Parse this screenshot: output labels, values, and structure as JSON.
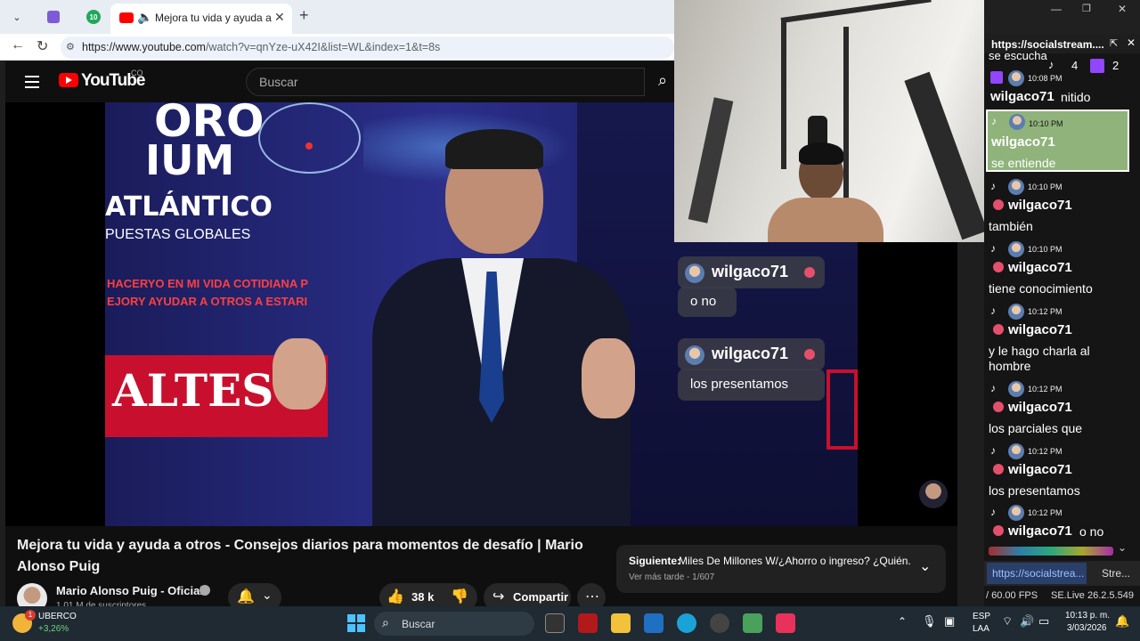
{
  "browser": {
    "tab_badge": "10",
    "active_tab_title": "Mejora tu vida y ayuda a otros - Consejos",
    "url_host": "https://www.youtube.com",
    "url_path": "/watch?v=qnYze-uX42I&list=WL&index=1&t=8s"
  },
  "youtube": {
    "logo_text": "YouTube",
    "country": "CO",
    "search_placeholder": "Buscar",
    "video_title": "Mejora tu vida y ayuda a otros - Consejos diarios para momentos de desafío | Mario Alonso Puig",
    "channel_name": "Mario Alonso Puig - Oficial",
    "subscribers": "1,01 M de suscriptores",
    "likes": "38 k",
    "share_label": "Compartir",
    "next_label": "Siguiente:",
    "next_title": "Miles De Millones W/¿Ahorro o ingreso? ¿Quién...",
    "next_sub": "Ver más tarde - 1/607"
  },
  "video_frame": {
    "line1": "ORO",
    "line2": "IUM",
    "line3": "ATLÁNTICO",
    "line4": "PUESTAS GLOBALES",
    "line5": "HACERYO EN MI VIDA COTIDIANA P",
    "line6": "EJORY AYUDAR A OTROS A ESTARI",
    "line7": "ALTES"
  },
  "overlay": {
    "bubbles": [
      {
        "user": "wilgaco71",
        "text": "o no"
      },
      {
        "user": "wilgaco71",
        "text": "los presentamos"
      }
    ]
  },
  "chat_panel": {
    "url": "https://socialstream....",
    "tiktok_count": "4",
    "twitch_count": "2",
    "top_partial": "se escucha",
    "messages": [
      {
        "time": "10:08 PM",
        "user": "wilgaco71",
        "text": "nitido",
        "platform": "twitch",
        "inline": true
      },
      {
        "time": "10:10 PM",
        "user": "wilgaco71",
        "text": "se entiende",
        "platform": "tiktok",
        "highlight": true
      },
      {
        "time": "10:10 PM",
        "user": "wilgaco71",
        "text": "también",
        "platform": "tiktok"
      },
      {
        "time": "10:10 PM",
        "user": "wilgaco71",
        "text": "tiene conocimiento",
        "platform": "tiktok"
      },
      {
        "time": "10:12 PM",
        "user": "wilgaco71",
        "text": "y le hago charla al hombre",
        "platform": "tiktok"
      },
      {
        "time": "10:12 PM",
        "user": "wilgaco71",
        "text": "los parciales que",
        "platform": "tiktok"
      },
      {
        "time": "10:12 PM",
        "user": "wilgaco71",
        "text": "los presentamos",
        "platform": "tiktok"
      },
      {
        "time": "10:12 PM",
        "user": "wilgaco71",
        "text": "o no",
        "platform": "tiktok",
        "inline": true
      }
    ],
    "bottom_tab1": "https://socialstrea...",
    "bottom_tab2": "Stre...",
    "fps": "/ 60.00 FPS",
    "version": "SE.Live 26.2.5.549"
  },
  "taskbar": {
    "stock_name": "UBERCO",
    "stock_change": "+3,26%",
    "stock_badge": "1",
    "search_label": "Buscar",
    "lang1": "ESP",
    "lang2": "LAA",
    "time": "10:13 p. m.",
    "date": "3/03/2026"
  }
}
